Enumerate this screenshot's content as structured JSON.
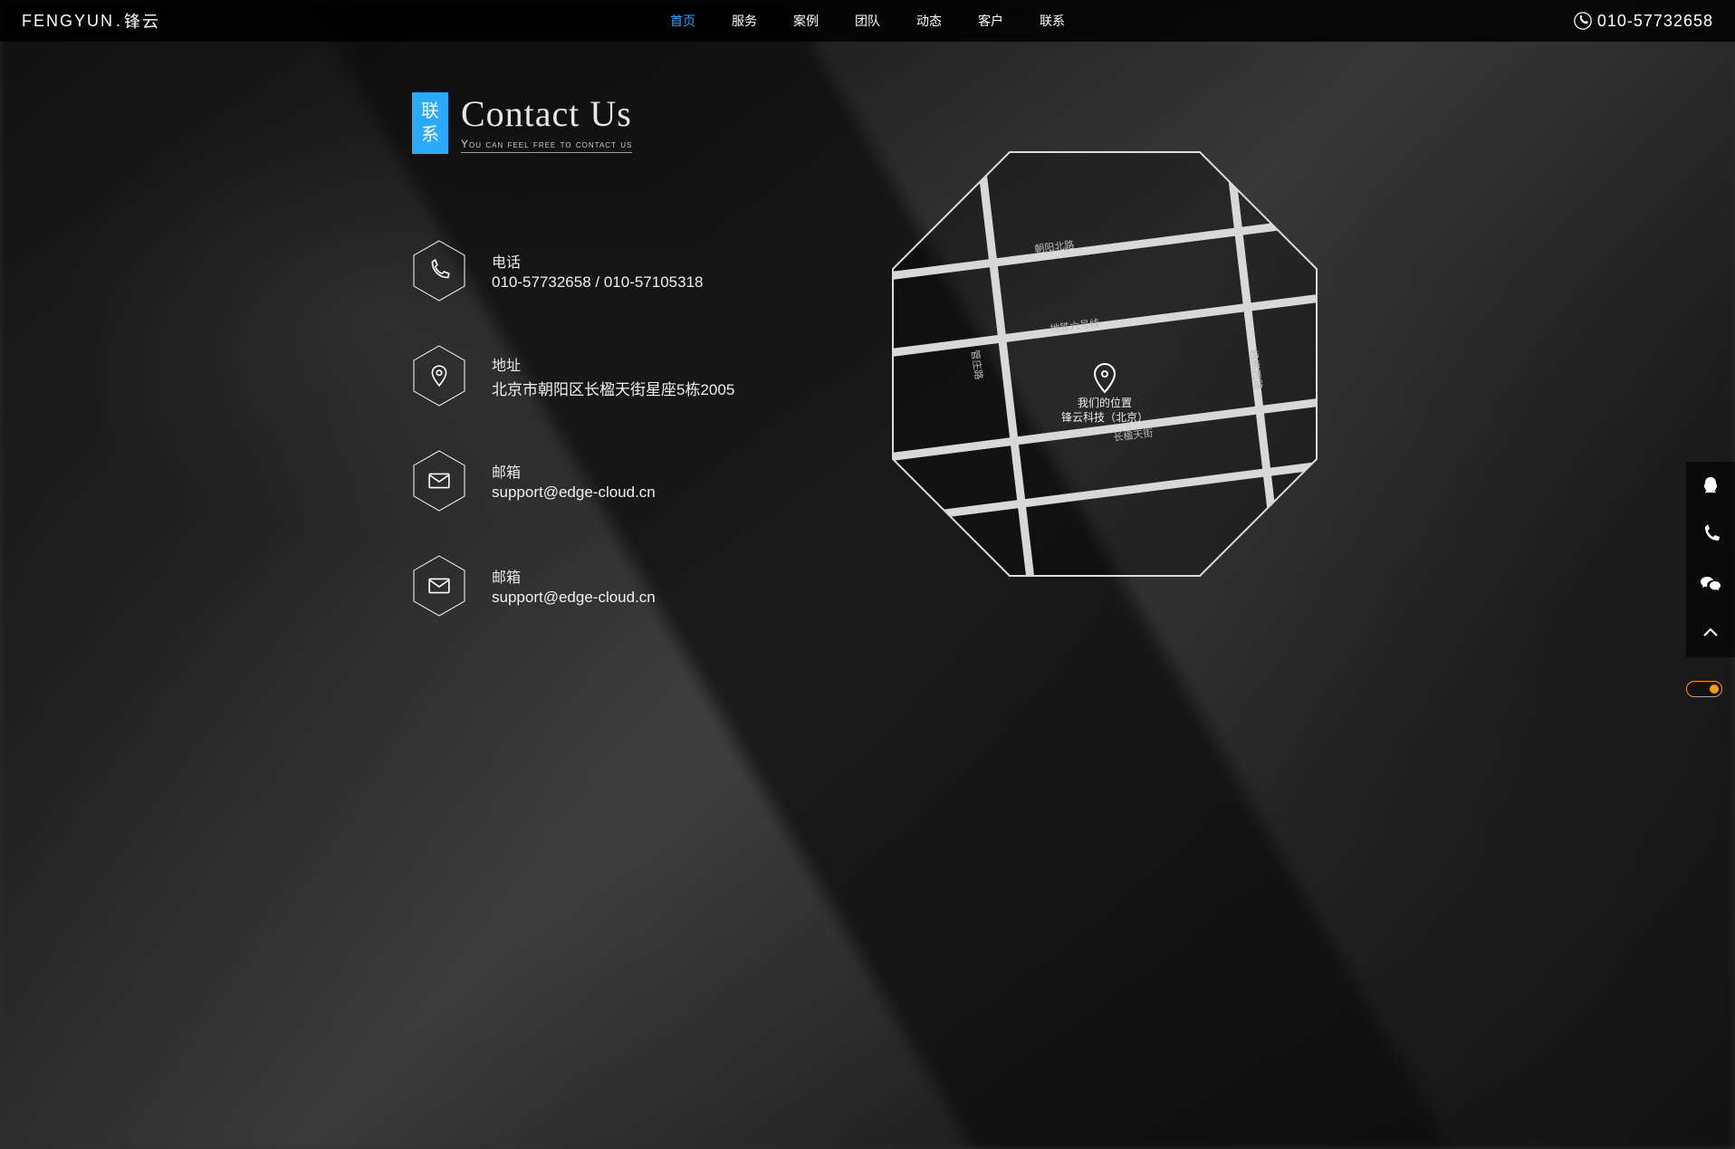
{
  "brand": {
    "text_en": "FENGYUN",
    "text_cn": "锋云"
  },
  "nav": {
    "items": [
      "首页",
      "服务",
      "案例",
      "团队",
      "动态",
      "客户",
      "联系"
    ],
    "active_index": 0,
    "phone_display": "010-57732658"
  },
  "heading": {
    "cn_char_1": "联",
    "cn_char_2": "系",
    "en": "Contact Us",
    "sub": "You can feel free to contact us"
  },
  "contact": {
    "phone": {
      "label": "电话",
      "value": "010-57732658 / 010-57105318"
    },
    "address": {
      "label": "地址",
      "value": "北京市朝阳区长楹天街星座5栋2005"
    },
    "email1": {
      "label": "邮箱",
      "value": "support@edge-cloud.cn"
    },
    "email2": {
      "label": "邮箱",
      "value": "support@edge-cloud.cn"
    }
  },
  "map": {
    "streets": [
      "朝阳北路",
      "地铁六号线",
      "长楹天街",
      "管庄路",
      "杨闸西路"
    ],
    "marker_line1": "我们的位置",
    "marker_line2": "锋云科技（北京）"
  },
  "side_buttons": [
    "qq",
    "phone",
    "wechat",
    "top"
  ]
}
